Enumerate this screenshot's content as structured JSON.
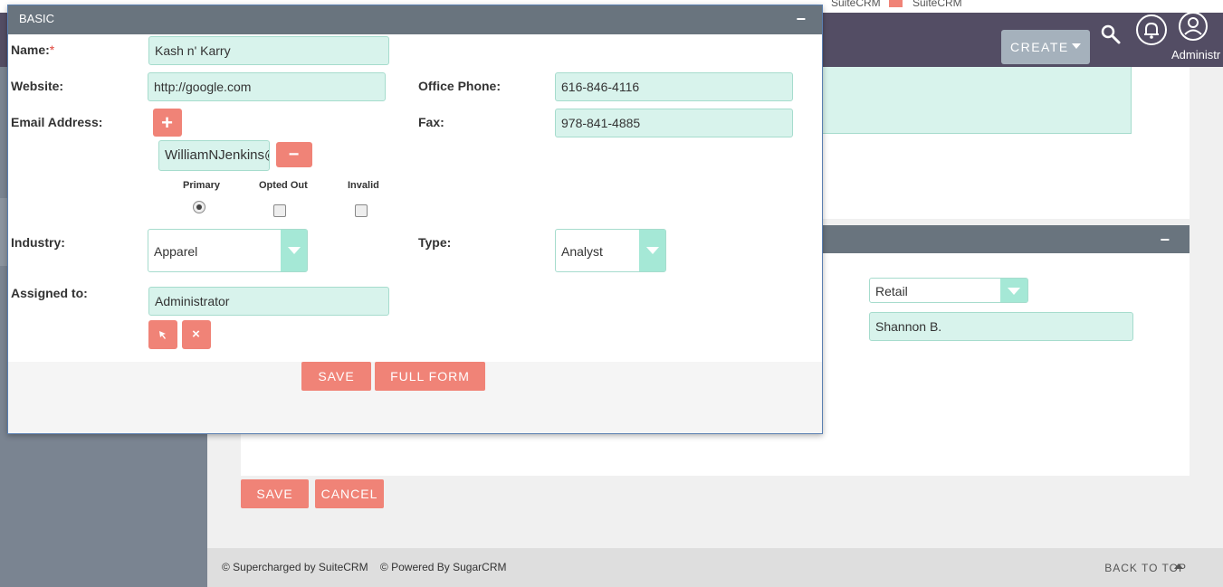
{
  "topbar": {
    "tab1": "SuiteCRM",
    "tab2": "SuiteCRM"
  },
  "navbar": {
    "create_label": "CREATE",
    "user_label": "Administr"
  },
  "background_panel": {
    "type_value": "Retail",
    "assigned_value": "Shannon B.",
    "save_label": "SAVE",
    "cancel_label": "CANCEL"
  },
  "footer": {
    "credits": "© Supercharged by SuiteCRM    © Powered By SugarCRM",
    "back_to_top": "BACK TO TOP"
  },
  "modal": {
    "section_title": "BASIC",
    "name_label": "Name:",
    "name_required": "*",
    "name_value": "Kash n' Karry",
    "website_label": "Website:",
    "website_value": "http://google.com",
    "office_phone_label": "Office Phone:",
    "office_phone_value": "616-846-4116",
    "email_label": "Email Address:",
    "email_value": "WilliamNJenkins@",
    "fax_label": "Fax:",
    "fax_value": "978-841-4885",
    "email_flags": {
      "primary": "Primary",
      "opted_out": "Opted Out",
      "invalid": "Invalid"
    },
    "industry_label": "Industry:",
    "industry_value": "Apparel",
    "type_label": "Type:",
    "type_value": "Analyst",
    "assigned_label": "Assigned to:",
    "assigned_value": "Administrator",
    "save_label": "SAVE",
    "full_form_label": "FULL FORM"
  },
  "colors": {
    "accent": "#f08377",
    "field_bg": "#d8f3ec",
    "header": "#69747e",
    "navbar": "#534d64"
  }
}
